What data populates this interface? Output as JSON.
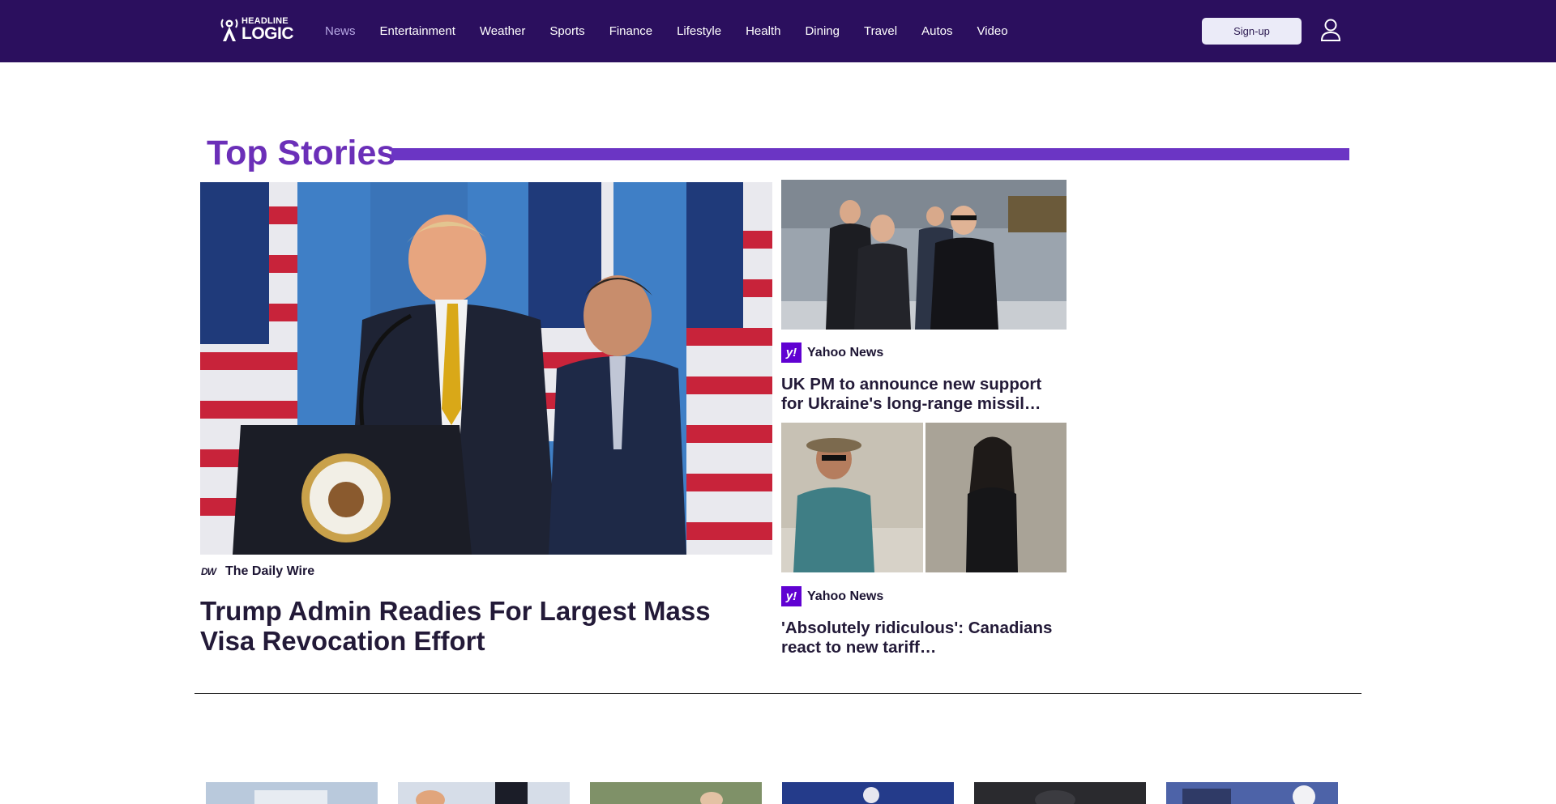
{
  "header": {
    "logo_top": "HEADLINE",
    "logo_bottom": "LOGIC",
    "nav": [
      {
        "label": "News",
        "active": true
      },
      {
        "label": "Entertainment"
      },
      {
        "label": "Weather"
      },
      {
        "label": "Sports"
      },
      {
        "label": "Finance"
      },
      {
        "label": "Lifestyle"
      },
      {
        "label": "Health"
      },
      {
        "label": "Dining"
      },
      {
        "label": "Travel"
      },
      {
        "label": "Autos"
      },
      {
        "label": "Video"
      }
    ],
    "signup_label": "Sign-up",
    "user_icon": "user-icon"
  },
  "top_stories": {
    "title": "Top Stories",
    "main": {
      "source_logo": "DW",
      "source": "The Daily Wire",
      "headline": "Trump Admin Readies For Largest Mass Visa Revocation Effort"
    },
    "side": [
      {
        "source_logo": "y!",
        "source": "Yahoo News",
        "headline": "UK PM to announce new support for Ukraine's long-range missil…"
      },
      {
        "source_logo": "y!",
        "source": "Yahoo News",
        "headline": "'Absolutely ridiculous': Canadians react to new tariff…"
      }
    ]
  },
  "colors": {
    "header_bg": "#2b0f5e",
    "accent": "#6b2fb8",
    "nav_active": "#b7a8e4",
    "yahoo_purple": "#6001d2"
  }
}
